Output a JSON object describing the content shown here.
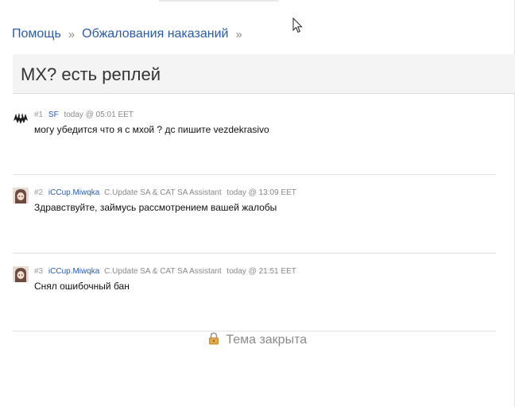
{
  "breadcrumb": {
    "items": [
      "Помощь",
      "Обжалования наказаний"
    ],
    "separator": "»"
  },
  "topic": {
    "title": "MX? есть реплей",
    "closed_label": "Тема закрыта"
  },
  "posts": [
    {
      "number": "#1",
      "user": "SF",
      "role": "",
      "time": "today @ 05:01 EET",
      "text": "могу убедится что я с мхой ? дс пишите vezdekrasivo",
      "avatar": "dark-logo"
    },
    {
      "number": "#2",
      "user": "iCCup.Miwqka",
      "role": "C.Update SA & CAT SA Assistant",
      "time": "today @ 13:09 EET",
      "text": "Здравствуйте, займусь рассмотрением вашей жалобы",
      "avatar": "anime-girl"
    },
    {
      "number": "#3",
      "user": "iCCup.Miwqka",
      "role": "C.Update SA & CAT SA Assistant",
      "time": "today @ 21:51 EET",
      "text": "Снял ошибочный бан",
      "avatar": "anime-girl"
    }
  ],
  "colors": {
    "link": "#2a5caa",
    "muted": "#888888",
    "title_bg": "#f4f4f4"
  },
  "icons": {
    "cursor": "mouse-pointer-icon",
    "lock": "lock-icon"
  }
}
